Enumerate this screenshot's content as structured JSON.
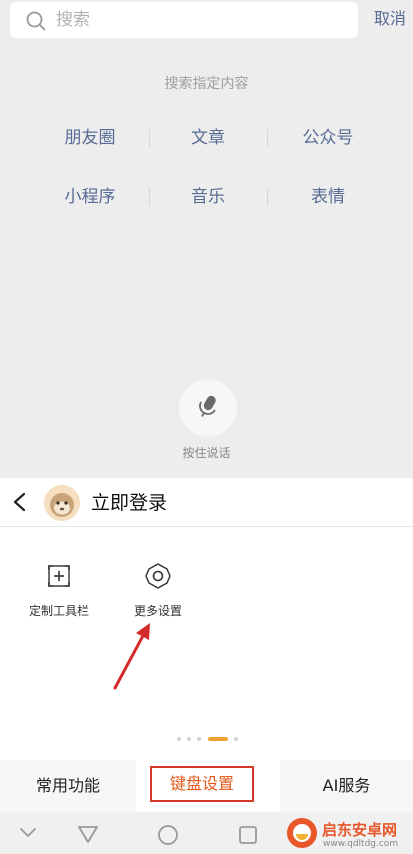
{
  "search": {
    "placeholder": "搜索",
    "cancel_label": "取消"
  },
  "search_hint": {
    "title": "搜索指定内容",
    "categories": [
      "朋友圈",
      "文章",
      "公众号",
      "小程序",
      "音乐",
      "表情"
    ]
  },
  "voice": {
    "label": "按住说话"
  },
  "keyboard_panel": {
    "login_label": "立即登录",
    "tools": [
      {
        "label": "定制工具栏",
        "icon": "add-square-icon"
      },
      {
        "label": "更多设置",
        "icon": "gear-icon"
      }
    ],
    "pager": {
      "pages": 5,
      "active_index": 3
    }
  },
  "bottom_tabs": [
    {
      "label": "常用功能"
    },
    {
      "label": "键盘设置",
      "selected": true
    },
    {
      "label": "AI服务"
    }
  ],
  "watermark": {
    "title": "启东安卓网",
    "url": "www.qdltdg.com"
  },
  "colors": {
    "link_blue": "#576b95",
    "highlight_red": "#d43a2a",
    "active_orange": "#e55a1c"
  }
}
